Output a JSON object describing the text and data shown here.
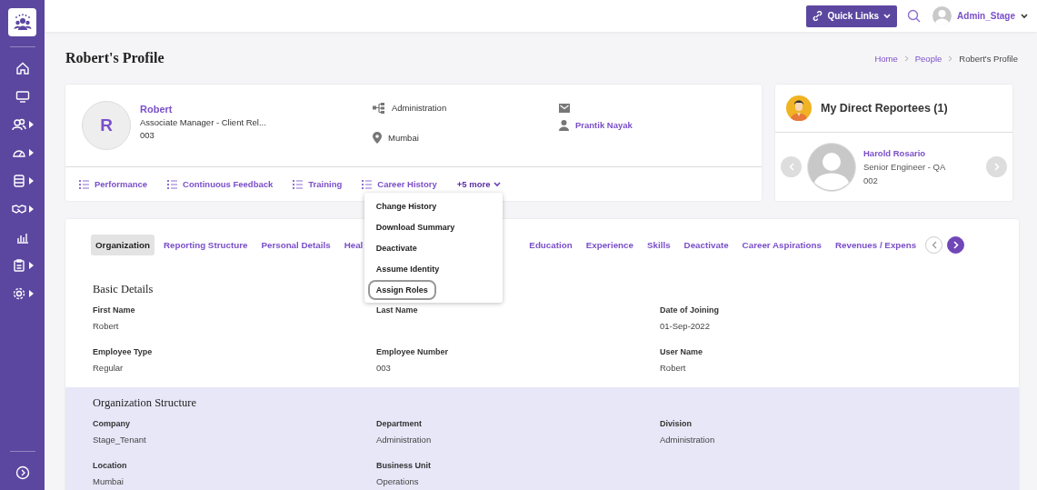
{
  "sidebar": {
    "items": [
      {
        "submenu": false
      },
      {
        "submenu": false
      },
      {
        "submenu": true
      },
      {
        "submenu": true
      },
      {
        "submenu": true
      },
      {
        "submenu": true
      },
      {
        "submenu": false
      },
      {
        "submenu": true
      },
      {
        "submenu": true
      }
    ]
  },
  "topbar": {
    "quick_links": "Quick Links",
    "user": "Admin_Stage"
  },
  "page": {
    "title": "Robert's Profile",
    "breadcrumb": [
      {
        "label": "Home",
        "link": true
      },
      {
        "label": "People",
        "link": true
      },
      {
        "label": "Robert's Profile",
        "link": false
      }
    ]
  },
  "profile": {
    "initial": "R",
    "name": "Robert",
    "designation": "Associate Manager - Client Rel...",
    "employee_id": "003",
    "department": "Administration",
    "location": "Mumbai",
    "manager": "Prantik Nayak",
    "links": [
      "Performance",
      "Continuous Feedback",
      "Training",
      "Career History"
    ],
    "more": "+5 more",
    "more_menu": [
      {
        "label": "Change History",
        "focused": false
      },
      {
        "label": "Download Summary",
        "focused": false
      },
      {
        "label": "Deactivate",
        "focused": false
      },
      {
        "label": "Assume Identity",
        "focused": false
      },
      {
        "label": "Assign Roles",
        "focused": true
      }
    ]
  },
  "reportees": {
    "title": "My Direct Reportees (1)",
    "people": [
      {
        "name": "Harold Rosario",
        "role": "Senior Engineer - QA",
        "id": "002"
      }
    ]
  },
  "tabs": [
    {
      "label": "Organization",
      "selected": true
    },
    {
      "label": "Reporting Structure",
      "selected": false
    },
    {
      "label": "Personal Details",
      "selected": false
    },
    {
      "label": "Heal",
      "selected": false
    },
    {
      "label": "Education",
      "selected": false
    },
    {
      "label": "Experience",
      "selected": false
    },
    {
      "label": "Skills",
      "selected": false
    },
    {
      "label": "Deactivate",
      "selected": false
    },
    {
      "label": "Career Aspirations",
      "selected": false
    },
    {
      "label": "Revenues / Expens",
      "selected": false
    }
  ],
  "tab_scroll": {
    "prev_enabled": false,
    "next_enabled": true
  },
  "sections": [
    {
      "title": "Basic Details",
      "shaded": false,
      "fields": [
        {
          "label": "First Name",
          "value": "Robert"
        },
        {
          "label": "Last Name"
        },
        {
          "label": "Date of Joining",
          "value": "01-Sep-2022"
        },
        {
          "label": "Employee Type",
          "value": "Regular"
        },
        {
          "label": "Employee Number",
          "value": "003"
        },
        {
          "label": "User Name",
          "value": "Robert"
        }
      ]
    },
    {
      "title": "Organization Structure",
      "shaded": true,
      "fields": [
        {
          "label": "Company",
          "value": "Stage_Tenant"
        },
        {
          "label": "Department",
          "value": "Administration"
        },
        {
          "label": "Division",
          "value": "Administration"
        },
        {
          "label": "Location",
          "value": "Mumbai"
        },
        {
          "label": "Business Unit",
          "value": "Operations"
        }
      ]
    }
  ]
}
